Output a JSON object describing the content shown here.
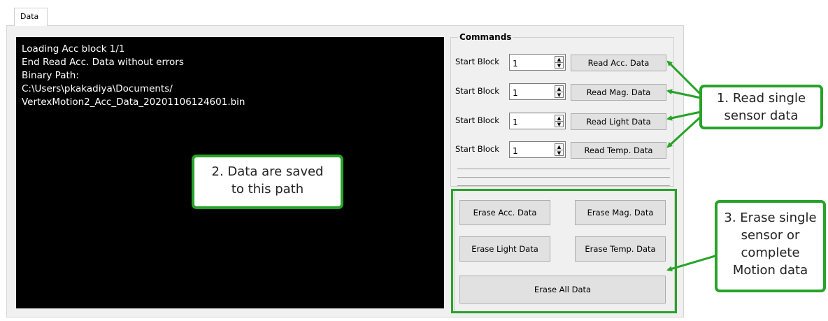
{
  "tab": {
    "label": "Data"
  },
  "console": {
    "lines": [
      "Loading Acc block 1/1",
      "End Read Acc. Data without errors",
      "Binary Path:",
      "C:\\Users\\pkakadiya\\Documents/",
      "VertexMotion2_Acc_Data_20201106124601.bin"
    ]
  },
  "commands": {
    "title": "Commands",
    "rows": [
      {
        "label": "Start Block",
        "value": "1",
        "button": "Read Acc. Data"
      },
      {
        "label": "Start Block",
        "value": "1",
        "button": "Read Mag. Data"
      },
      {
        "label": "Start Block",
        "value": "1",
        "button": "Read Light Data"
      },
      {
        "label": "Start Block",
        "value": "1",
        "button": "Read Temp. Data"
      }
    ]
  },
  "erase": {
    "acc": "Erase Acc. Data",
    "mag": "Erase Mag. Data",
    "light": "Erase Light Data",
    "temp": "Erase Temp. Data",
    "all": "Erase All Data"
  },
  "callouts": {
    "read": [
      "1. Read single",
      "sensor data"
    ],
    "path": [
      "2. Data are saved",
      "to this path"
    ],
    "erase": [
      "3. Erase single",
      "sensor or",
      "complete",
      "Motion data"
    ]
  },
  "colors": {
    "annotation": "#27a328",
    "console_bg": "#000000",
    "panel_bg": "#f0f0f0"
  }
}
